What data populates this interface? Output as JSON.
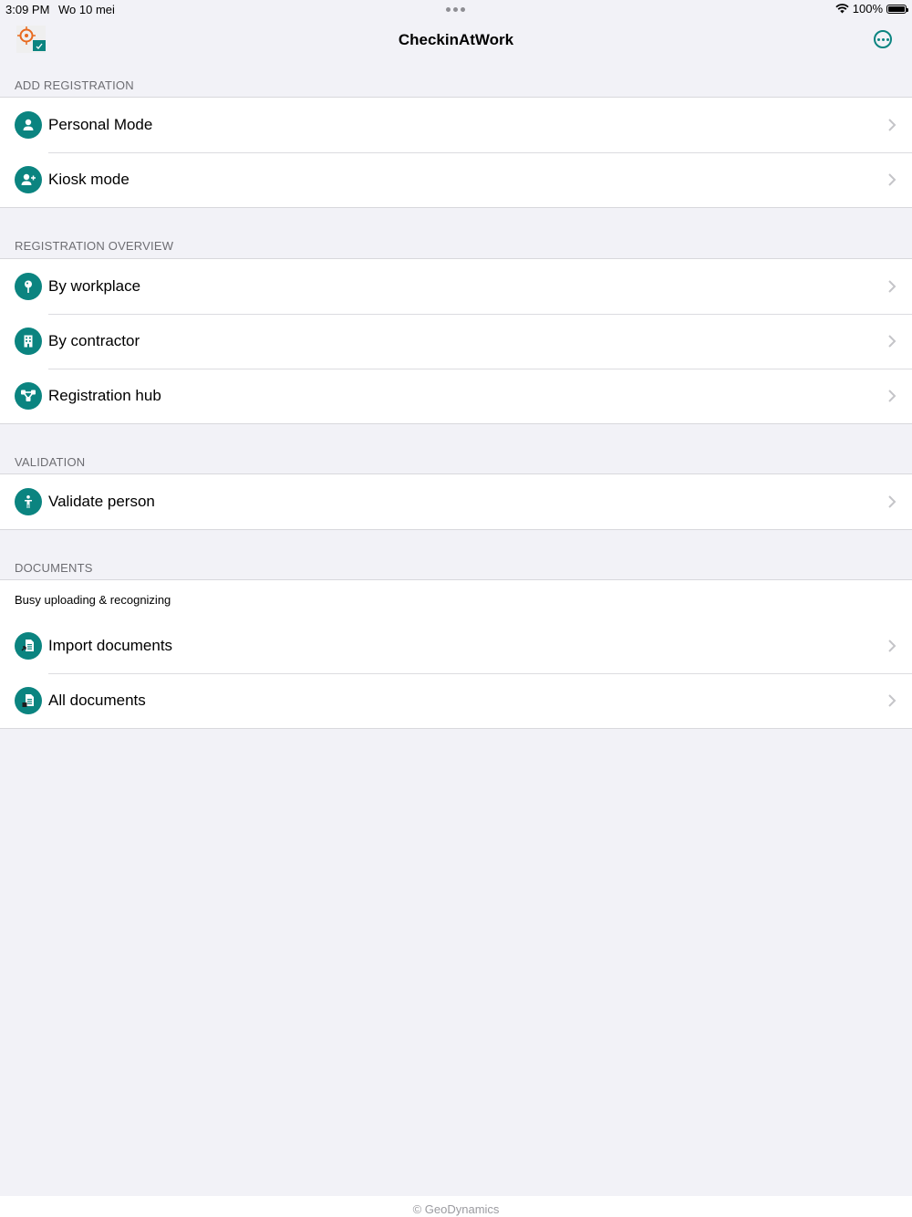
{
  "status_bar": {
    "time": "3:09 PM",
    "date": "Wo 10 mei",
    "battery": "100%",
    "battery_level": 1.0
  },
  "nav": {
    "title": "CheckinAtWork",
    "more_icon": "ellipsis-circle-icon"
  },
  "colors": {
    "accent": "#0b8480",
    "background": "#f2f2f7",
    "section_text": "#6d6d72"
  },
  "sections": {
    "add_registration": {
      "header": "ADD REGISTRATION",
      "items": [
        {
          "label": "Personal Mode",
          "icon": "person-icon"
        },
        {
          "label": "Kiosk mode",
          "icon": "person-add-icon"
        }
      ]
    },
    "registration_overview": {
      "header": "REGISTRATION OVERVIEW",
      "items": [
        {
          "label": "By workplace",
          "icon": "location-pin-icon"
        },
        {
          "label": "By contractor",
          "icon": "building-icon"
        },
        {
          "label": "Registration hub",
          "icon": "hub-icon"
        }
      ]
    },
    "validation": {
      "header": "VALIDATION",
      "items": [
        {
          "label": "Validate person",
          "icon": "person-standing-icon"
        }
      ]
    },
    "documents": {
      "header": "DOCUMENTS",
      "status": "Busy uploading & recognizing",
      "items": [
        {
          "label": "Import documents",
          "icon": "document-import-icon"
        },
        {
          "label": "All documents",
          "icon": "documents-icon"
        }
      ]
    }
  },
  "footer": {
    "text": "© GeoDynamics"
  }
}
